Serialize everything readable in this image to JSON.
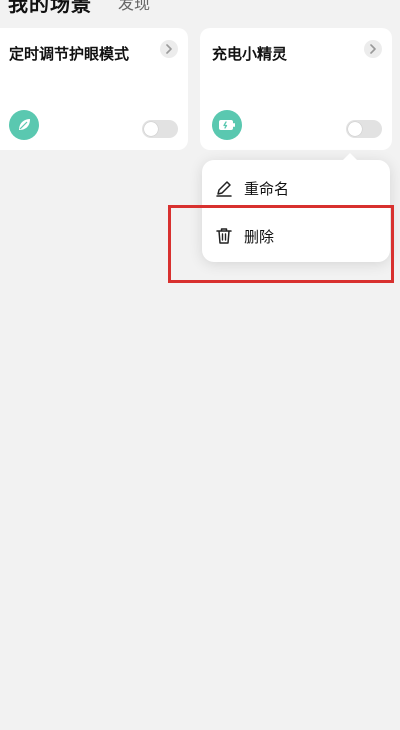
{
  "header": {
    "title": "我的场景",
    "tab": "发现"
  },
  "cards": [
    {
      "title": "定时调节护眼模式",
      "icon": "leaf-icon",
      "enabled": false
    },
    {
      "title": "充电小精灵",
      "icon": "battery-icon",
      "enabled": false
    }
  ],
  "context_menu": {
    "items": [
      {
        "label": "重命名",
        "icon": "pencil-icon"
      },
      {
        "label": "删除",
        "icon": "trash-icon"
      }
    ]
  },
  "colors": {
    "background": "#f2f2f2",
    "card": "#ffffff",
    "icon_accent": "#5ac8b0",
    "highlight": "#d8312f"
  }
}
